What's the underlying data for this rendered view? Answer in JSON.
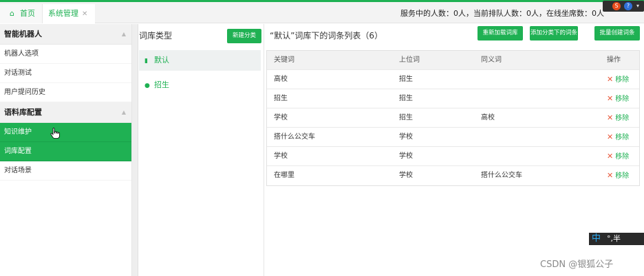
{
  "tabs": {
    "home_label": "首页",
    "system_label": "系统管理"
  },
  "status": {
    "text": "服务中的人数：0人，当前排队人数：0人，在线坐席数：0人"
  },
  "sidebar": {
    "sections": [
      {
        "title": "智能机器人",
        "items": [
          {
            "label": "机器人选项"
          },
          {
            "label": "对话测试"
          },
          {
            "label": "用户提问历史"
          }
        ]
      },
      {
        "title": "语料库配置",
        "items": [
          {
            "label": "知识维护",
            "active": true
          },
          {
            "label": "词库配置",
            "active": true
          },
          {
            "label": "对话场景"
          }
        ]
      }
    ]
  },
  "category": {
    "title": "词库类型",
    "new_button": "新建分类",
    "items": [
      {
        "label": "默认",
        "icon": "book-icon"
      },
      {
        "label": "招生",
        "icon": "users-icon"
      }
    ]
  },
  "wordlist": {
    "title": "“默认”词库下的词条列表（6）",
    "buttons": {
      "reload": "重新加载词库",
      "add_to_category": "添加分类下的词条",
      "batch_create": "批量创建词条"
    },
    "headers": [
      "关键词",
      "上位词",
      "同义词",
      "操作"
    ],
    "remove_label": "移除",
    "rows": [
      {
        "keyword": "高校",
        "hypernym": "招生",
        "synonym": ""
      },
      {
        "keyword": "招生",
        "hypernym": "招生",
        "synonym": ""
      },
      {
        "keyword": "学校",
        "hypernym": "招生",
        "synonym": "高校"
      },
      {
        "keyword": "搭什么公交车",
        "hypernym": "学校",
        "synonym": ""
      },
      {
        "keyword": "学校",
        "hypernym": "学校",
        "synonym": ""
      },
      {
        "keyword": "在哪里",
        "hypernym": "学校",
        "synonym": "搭什么公交车"
      }
    ]
  },
  "ime": {
    "mode": "中",
    "rest": "°,半"
  },
  "watermark": "CSDN @银狐公子",
  "colors": {
    "accent": "#1fb153",
    "remove_x": "#e8583a"
  }
}
